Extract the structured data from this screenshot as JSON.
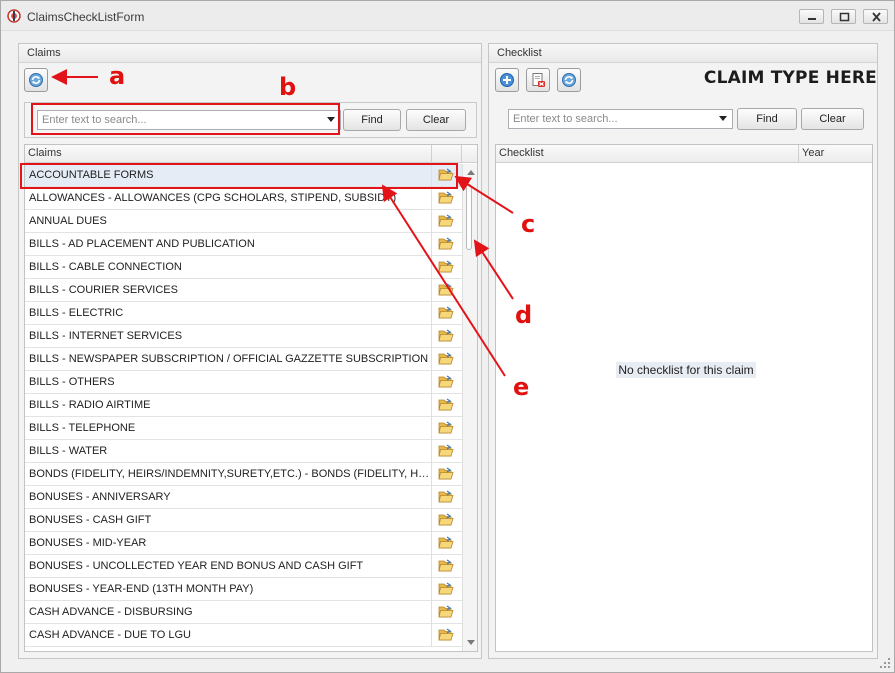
{
  "window": {
    "title": "ClaimsCheckListForm"
  },
  "claims_panel": {
    "header": "Claims",
    "search": {
      "placeholder": "Enter text to search...",
      "value": ""
    },
    "find_label": "Find",
    "clear_label": "Clear",
    "grid": {
      "column": "Claims",
      "rows": [
        "ACCOUNTABLE FORMS",
        "ALLOWANCES - ALLOWANCES (CPG SCHOLARS, STIPEND, SUBSIDY)",
        "ANNUAL DUES",
        "BILLS - AD PLACEMENT AND PUBLICATION",
        "BILLS - CABLE CONNECTION",
        "BILLS - COURIER SERVICES",
        "BILLS - ELECTRIC",
        "BILLS - INTERNET SERVICES",
        "BILLS - NEWSPAPER SUBSCRIPTION / OFFICIAL GAZZETTE SUBSCRIPTION",
        "BILLS - OTHERS",
        "BILLS - RADIO AIRTIME",
        "BILLS - TELEPHONE",
        "BILLS - WATER",
        "BONDS (FIDELITY, HEIRS/INDEMNITY,SURETY,ETC.) - BONDS (FIDELITY, HEIRS/INDEMNITY,SURETY,ETC.)",
        "BONUSES - ANNIVERSARY",
        "BONUSES - CASH GIFT",
        "BONUSES - MID-YEAR",
        "BONUSES - UNCOLLECTED YEAR END BONUS AND CASH GIFT",
        "BONUSES - YEAR-END (13TH MONTH PAY)",
        "CASH ADVANCE - DISBURSING",
        "CASH ADVANCE - DUE TO LGU"
      ],
      "selected_index": 0
    }
  },
  "checklist_panel": {
    "header": "Checklist",
    "claim_type": "CLAIM TYPE HERE",
    "search": {
      "placeholder": "Enter text to search...",
      "value": ""
    },
    "find_label": "Find",
    "clear_label": "Clear",
    "grid": {
      "columns": [
        "Checklist",
        "Year"
      ],
      "empty_message": "No checklist for this claim"
    }
  },
  "annotations": {
    "a": "a",
    "b": "b",
    "c": "c",
    "d": "d",
    "e": "e",
    "color": "#e3131a"
  }
}
